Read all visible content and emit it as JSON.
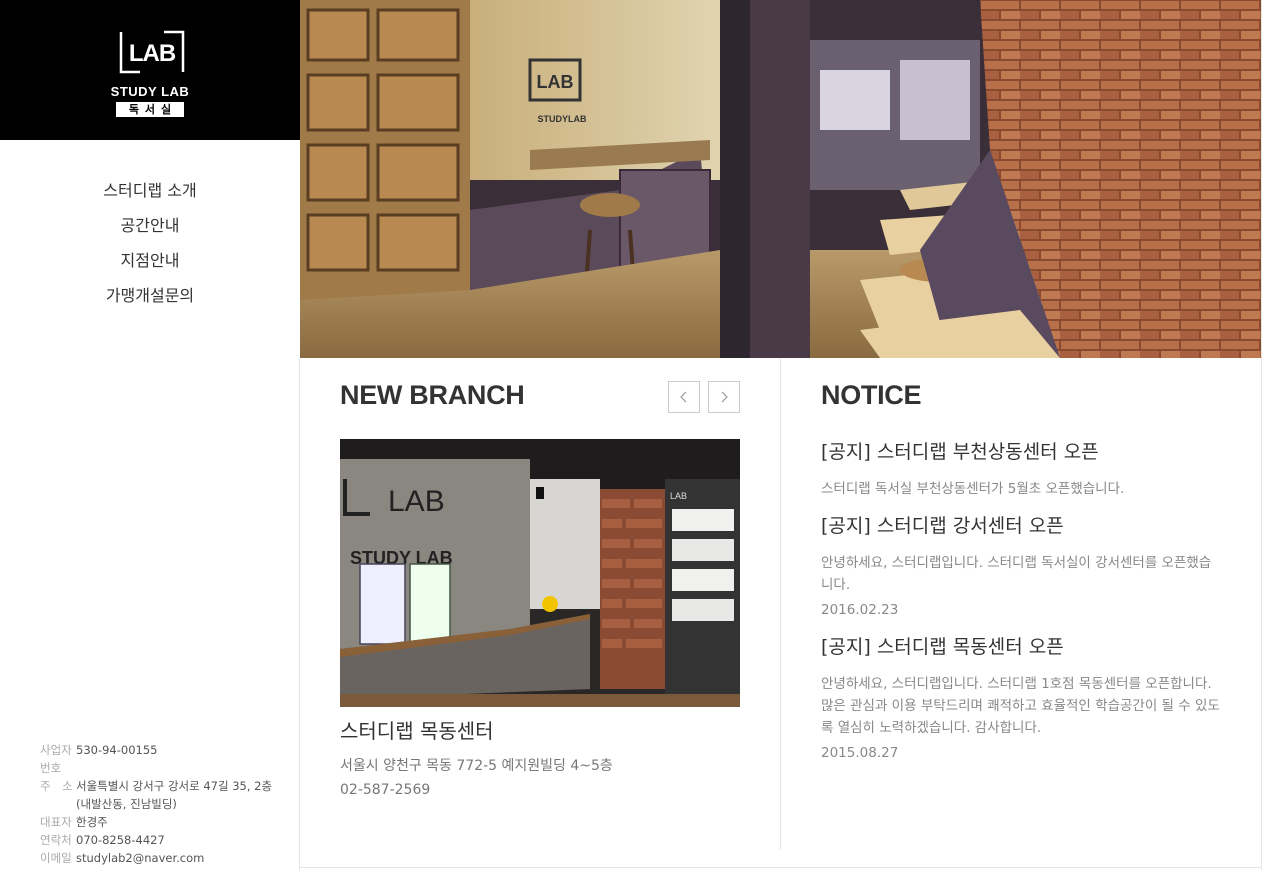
{
  "brand": {
    "logo_mark": "LAB",
    "name": "STUDY LAB",
    "subtitle": "독서실"
  },
  "menu": [
    {
      "label": "스터디랩 소개"
    },
    {
      "label": "공간안내"
    },
    {
      "label": "지점안내"
    },
    {
      "label": "가맹개설문의"
    }
  ],
  "company_info": [
    {
      "key": "사업자번호",
      "value": "530-94-00155"
    },
    {
      "key": "주　소",
      "value": "서울특별시 강서구 강서로 47길 35, 2층"
    },
    {
      "key": "",
      "value": "(내발산동, 진남빌딩)"
    },
    {
      "key": "대표자",
      "value": "한경주"
    },
    {
      "key": "연락처",
      "value": "070-8258-4427"
    },
    {
      "key": "이메일",
      "value": "studylab2@naver.com"
    }
  ],
  "new_branch": {
    "title": "NEW BRANCH",
    "prev_icon": "chevron-left-icon",
    "next_icon": "chevron-right-icon",
    "name": "스터디랩 목동센터",
    "address": "서울시 양천구 목동 772-5 예지원빌딩 4~5층",
    "phone": "02-587-2569"
  },
  "notice": {
    "title": "NOTICE",
    "items": [
      {
        "title": "[공지] 스터디랩 부천상동센터 오픈",
        "body": "스터디랩 독서실 부천상동센터가 5월초 오픈했습니다.",
        "date": ""
      },
      {
        "title": "[공지] 스터디랩 강서센터 오픈",
        "body": "안녕하세요, 스터디랩입니다. 스터디랩 독서실이 강서센터를 오픈했습니다.",
        "date": "2016.02.23"
      },
      {
        "title": "[공지] 스터디랩 목동센터 오픈",
        "body": "안녕하세요, 스터디랩입니다. 스터디랩 1호점 목동센터를 오픈합니다. 많은 관심과 이용 부탁드리며 쾌적하고 효율적인 학습공간이 될 수 있도록 열심히 노력하겠습니다. 감사합니다.",
        "date": "2015.08.27"
      }
    ]
  }
}
